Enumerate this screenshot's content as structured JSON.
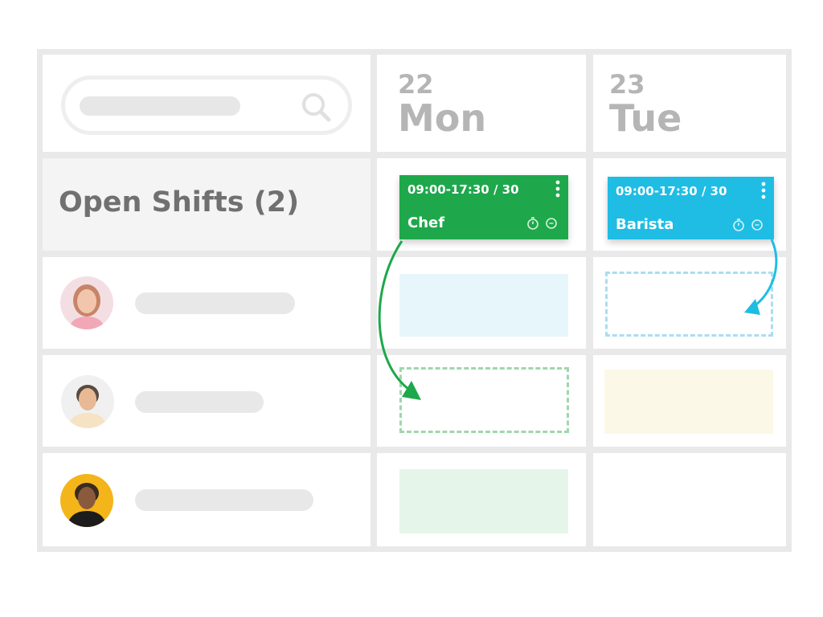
{
  "calendar": {
    "days": [
      {
        "number": "22",
        "name": "Mon"
      },
      {
        "number": "23",
        "name": "Tue"
      }
    ],
    "open_shifts_label": "Open Shifts (2)",
    "shifts": [
      {
        "time": "09:00-17:30 / 30",
        "role": "Chef",
        "color": "#1ea84b"
      },
      {
        "time": "09:00-17:30 / 30",
        "role": "Barista",
        "color": "#1fbde4"
      }
    ]
  },
  "colors": {
    "grid": "#e9e9e9",
    "text_muted": "#b5b5b5",
    "slot_blue": "#e6f6fb",
    "slot_yellow": "#fbf8e7",
    "slot_green": "#e6f5ea",
    "arrow_green": "#1ea84b",
    "arrow_blue": "#1fbde4"
  },
  "icons": [
    "search-icon",
    "kebab-menu-icon",
    "stopwatch-icon",
    "comment-icon"
  ]
}
